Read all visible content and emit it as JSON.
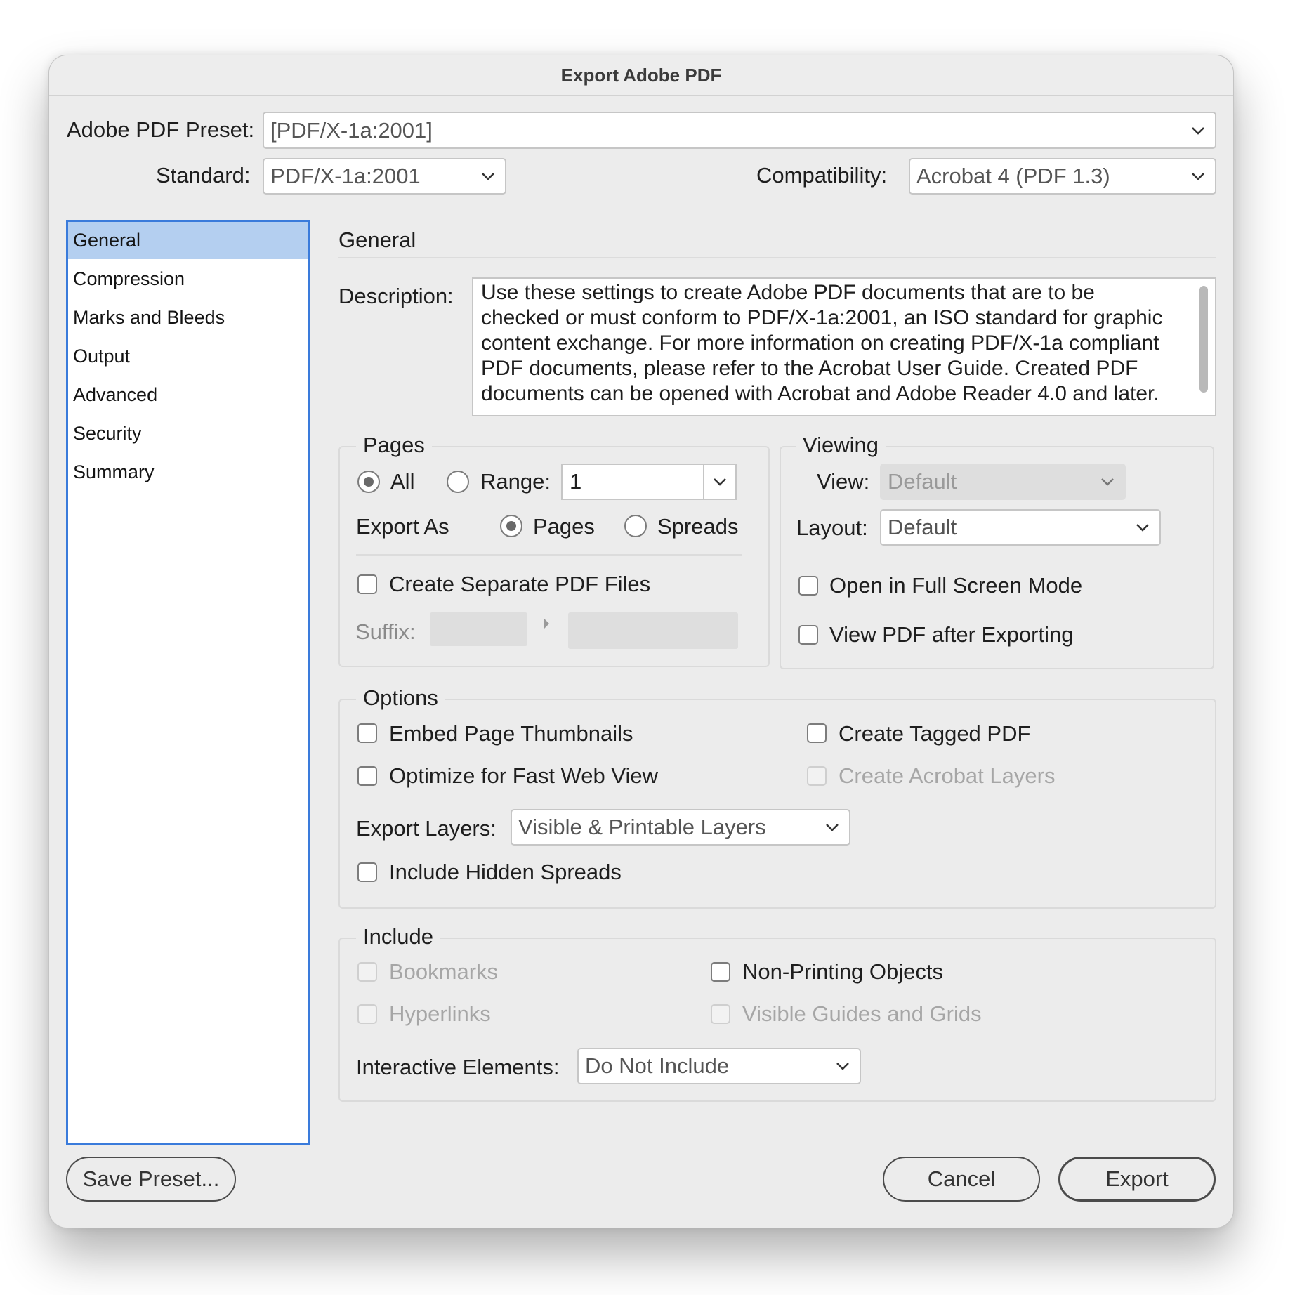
{
  "dialog": {
    "title": "Export Adobe PDF"
  },
  "preset": {
    "label": "Adobe PDF Preset:",
    "value": "[PDF/X-1a:2001]"
  },
  "standard": {
    "label": "Standard:",
    "value": "PDF/X-1a:2001"
  },
  "compatibility": {
    "label": "Compatibility:",
    "value": "Acrobat 4 (PDF 1.3)"
  },
  "sidebar": {
    "items": [
      {
        "label": "General",
        "selected": true
      },
      {
        "label": "Compression"
      },
      {
        "label": "Marks and Bleeds"
      },
      {
        "label": "Output"
      },
      {
        "label": "Advanced"
      },
      {
        "label": "Security"
      },
      {
        "label": "Summary"
      }
    ]
  },
  "panel": {
    "heading": "General",
    "description_label": "Description:",
    "description_text": "Use these settings to create Adobe PDF documents that are to be checked or must conform to PDF/X-1a:2001, an ISO standard for graphic content exchange.  For more information on creating PDF/X-1a compliant PDF documents, please refer to the Acrobat User Guide.  Created PDF documents can be opened with Acrobat and Adobe Reader 4.0 and later."
  },
  "pages": {
    "title": "Pages",
    "all_label": "All",
    "range_label": "Range:",
    "range_value": "1",
    "export_as_label": "Export As",
    "pages_option": "Pages",
    "spreads_option": "Spreads",
    "separate_files_label": "Create Separate PDF Files",
    "suffix_label": "Suffix:"
  },
  "viewing": {
    "title": "Viewing",
    "view_label": "View:",
    "view_value": "Default",
    "layout_label": "Layout:",
    "layout_value": "Default",
    "full_screen_label": "Open in Full Screen Mode",
    "view_after_label": "View PDF after Exporting"
  },
  "options": {
    "title": "Options",
    "embed_thumbnails": "Embed Page Thumbnails",
    "optimize_web": "Optimize for Fast Web View",
    "tagged_pdf": "Create Tagged PDF",
    "acrobat_layers": "Create Acrobat Layers",
    "export_layers_label": "Export Layers:",
    "export_layers_value": "Visible & Printable Layers",
    "hidden_spreads": "Include Hidden Spreads"
  },
  "include": {
    "title": "Include",
    "bookmarks": "Bookmarks",
    "hyperlinks": "Hyperlinks",
    "non_printing": "Non-Printing Objects",
    "guides_grids": "Visible Guides and Grids",
    "interactive_label": "Interactive Elements:",
    "interactive_value": "Do Not Include"
  },
  "buttons": {
    "save_preset": "Save Preset...",
    "cancel": "Cancel",
    "export": "Export"
  },
  "colors": {
    "sidebar_border": "#3a7bdb",
    "sidebar_selected": "#b4cff0",
    "dialog_bg": "#ececec"
  }
}
